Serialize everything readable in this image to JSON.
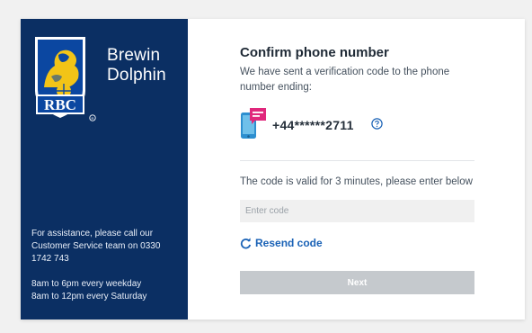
{
  "brand": {
    "logo_text": "RBC",
    "line1": "Brewin",
    "line2": "Dolphin"
  },
  "support": {
    "assistance": "For assistance, please call our Customer Service team on 0330 1742 743",
    "hours_weekday": "8am to 6pm every weekday",
    "hours_saturday": "8am to 12pm every Saturday"
  },
  "verify": {
    "title": "Confirm phone number",
    "description": "We have sent a verification code to the phone number ending:",
    "phone_number": "+44******2711",
    "validity_text": "The code is valid for 3 minutes, please enter below",
    "code_placeholder": "Enter code",
    "code_value": "",
    "resend_label": "Resend code",
    "next_label": "Next"
  },
  "colors": {
    "panel_bg": "#0b2f63",
    "accent_link": "#1a62b6",
    "message_badge": "#e0287c",
    "next_disabled": "#c5c9cd"
  },
  "icons": {
    "logo": "rbc-lion-shield",
    "phone": "phone-message-icon",
    "help": "help-circle-icon",
    "resend": "refresh-icon"
  }
}
